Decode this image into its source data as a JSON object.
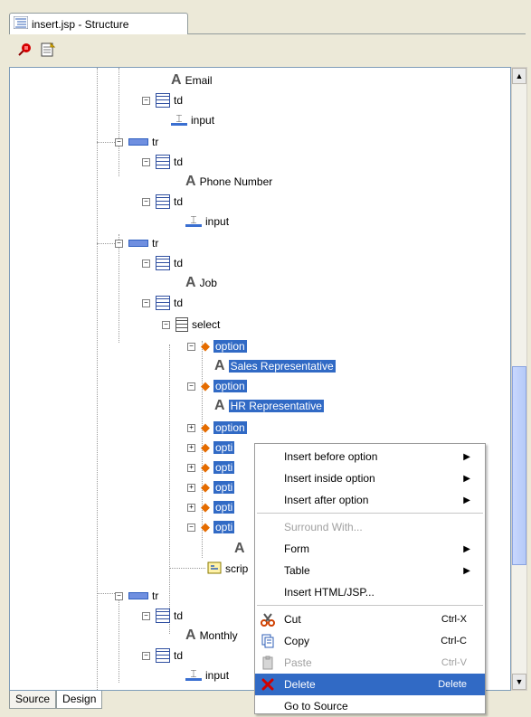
{
  "window": {
    "tab_title": "insert.jsp - Structure",
    "toolbar": {
      "pin_icon": "pin-icon",
      "edit_icon": "edit-properties-icon"
    },
    "bottom_tabs": [
      "Source",
      "Design"
    ],
    "active_bottom_tab": "Design"
  },
  "tree": {
    "nodes": [
      {
        "label": "Email",
        "icon": "text-icon"
      },
      {
        "label": "td",
        "icon": "td-icon"
      },
      {
        "label": "input",
        "icon": "input-icon"
      },
      {
        "label": "tr",
        "icon": "tr-icon"
      },
      {
        "label": "td",
        "icon": "td-icon"
      },
      {
        "label": "Phone Number",
        "icon": "text-icon"
      },
      {
        "label": "td",
        "icon": "td-icon"
      },
      {
        "label": "input",
        "icon": "input-icon"
      },
      {
        "label": "tr",
        "icon": "tr-icon"
      },
      {
        "label": "td",
        "icon": "td-icon"
      },
      {
        "label": "Job",
        "icon": "text-icon"
      },
      {
        "label": "td",
        "icon": "td-icon"
      },
      {
        "label": "select",
        "icon": "select-icon"
      },
      {
        "label": "option",
        "icon": "option-icon"
      },
      {
        "label": "Sales Representative",
        "icon": "text-icon"
      },
      {
        "label": "option",
        "icon": "option-icon"
      },
      {
        "label": "HR Representative",
        "icon": "text-icon"
      },
      {
        "label": "option",
        "icon": "option-icon"
      },
      {
        "label": "opti",
        "icon": "option-icon"
      },
      {
        "label": "opti",
        "icon": "option-icon"
      },
      {
        "label": "opti",
        "icon": "option-icon"
      },
      {
        "label": "opti",
        "icon": "option-icon"
      },
      {
        "label": "opti",
        "icon": "option-icon"
      },
      {
        "label": "",
        "icon": "text-icon"
      },
      {
        "label": "scrip",
        "icon": "script-icon"
      },
      {
        "label": "tr",
        "icon": "tr-icon"
      },
      {
        "label": "td",
        "icon": "td-icon"
      },
      {
        "label": "Monthly",
        "icon": "text-icon"
      },
      {
        "label": "td",
        "icon": "td-icon"
      },
      {
        "label": "input",
        "icon": "input-icon"
      }
    ]
  },
  "context_menu": {
    "items": [
      {
        "label": "Insert before option",
        "submenu": true
      },
      {
        "label": "Insert inside option",
        "submenu": true
      },
      {
        "label": "Insert after option",
        "submenu": true
      },
      {
        "label": "Surround With...",
        "disabled": true
      },
      {
        "label": "Form",
        "submenu": true
      },
      {
        "label": "Table",
        "submenu": true
      },
      {
        "label": "Insert HTML/JSP..."
      },
      {
        "label": "Cut",
        "shortcut": "Ctrl-X",
        "icon": "scissors-icon"
      },
      {
        "label": "Copy",
        "shortcut": "Ctrl-C",
        "icon": "copy-icon"
      },
      {
        "label": "Paste",
        "shortcut": "Ctrl-V",
        "icon": "paste-icon",
        "disabled": true
      },
      {
        "label": "Delete",
        "shortcut": "Delete",
        "icon": "delete-icon",
        "active": true
      },
      {
        "label": "Go to Source"
      }
    ]
  },
  "colors": {
    "selection": "#316ac5",
    "tree_background": "#ffffff",
    "window_background": "#ece9d8"
  }
}
